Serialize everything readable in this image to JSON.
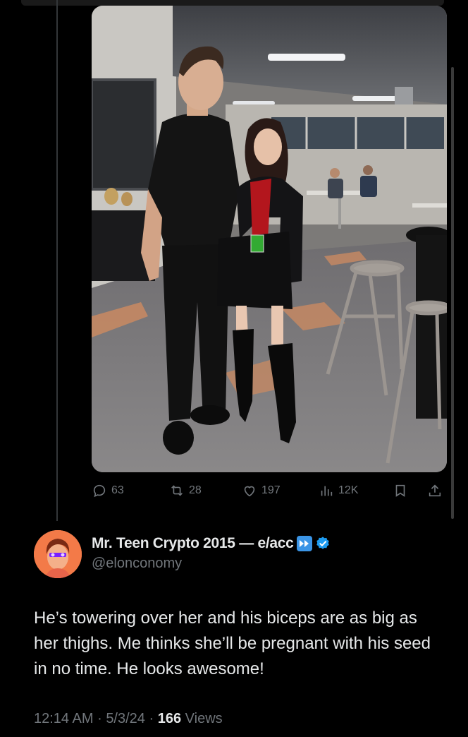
{
  "tweet": {
    "photo_alt": "",
    "actions": {
      "replies": "63",
      "retweets": "28",
      "likes": "197",
      "views": "12K"
    }
  },
  "reply": {
    "display_name": "Mr. Teen Crypto 2015 — e/acc",
    "handle": "@elonconomy",
    "verified": true,
    "text": "He’s towering over her and his biceps are as big as her thighs. Me thinks she’ll be pregnant with his seed in no time. He looks awesome!",
    "time": "12:14 AM",
    "separator": "·",
    "date": "5/3/24",
    "views_count": "166",
    "views_label": "Views"
  },
  "colors": {
    "background": "#000000",
    "text": "#e7e9ea",
    "secondary": "#71767b",
    "verified": "#1d9bf0",
    "accent_badge": "#3b95e6"
  },
  "icons": [
    "reply-icon",
    "retweet-icon",
    "like-icon",
    "views-icon",
    "bookmark-icon",
    "share-icon",
    "fast-forward-icon",
    "verified-badge-icon"
  ]
}
